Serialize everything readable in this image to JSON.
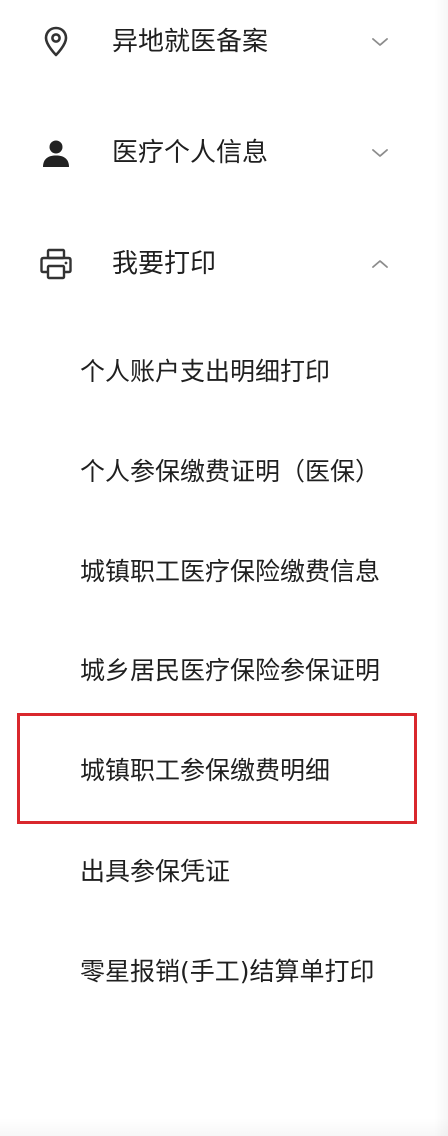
{
  "menu": {
    "sections": [
      {
        "label": "异地就医备案",
        "icon": "location-pin-icon",
        "state_icon": "chevron-down-icon"
      },
      {
        "label": "医疗个人信息",
        "icon": "person-icon",
        "state_icon": "chevron-down-icon"
      },
      {
        "label": "我要打印",
        "icon": "printer-icon",
        "state_icon": "chevron-up-icon",
        "expanded": true,
        "items": [
          {
            "label": "个人账户支出明细打印"
          },
          {
            "label": "个人参保缴费证明（医保）"
          },
          {
            "label": "城镇职工医疗保险缴费信息"
          },
          {
            "label": "城乡居民医疗保险参保证明"
          },
          {
            "label": "城镇职工参保缴费明细",
            "highlighted": true
          },
          {
            "label": "出具参保凭证"
          },
          {
            "label": "零星报销(手工)结算单打印"
          }
        ]
      }
    ]
  },
  "colors": {
    "text": "#1f1f1f",
    "icon": "#333333",
    "chevron": "#8c8c8c",
    "highlight_border": "#d9282d",
    "background": "#ffffff"
  }
}
